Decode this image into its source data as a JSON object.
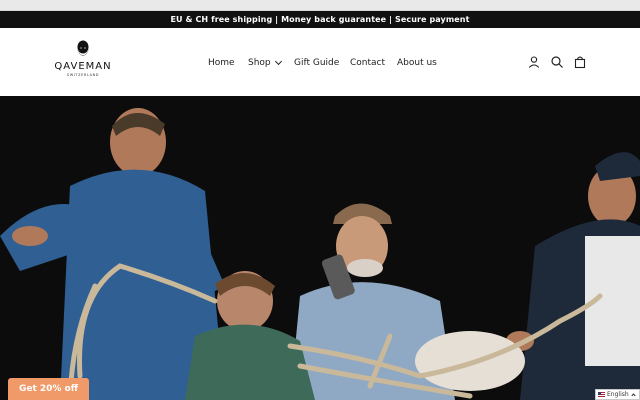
{
  "announcement": {
    "text": "EU & CH free shipping | Money back guarantee | Secure payment"
  },
  "logo": {
    "wordmark": "QAVEMAN",
    "tagline": "SWITZERLAND"
  },
  "nav": {
    "items": [
      {
        "label": "Home"
      },
      {
        "label": "Shop"
      },
      {
        "label": "Gift Guide"
      },
      {
        "label": "Contact"
      },
      {
        "label": "About us"
      }
    ]
  },
  "header_icons": [
    "account-icon",
    "search-icon",
    "cart-icon"
  ],
  "promo": {
    "button_label": "Get 20% off",
    "color": "#f09a6a"
  },
  "language": {
    "selected": "English"
  },
  "colors": {
    "announcement_bg": "#111111",
    "hero_bg": "#0c0c0c"
  }
}
